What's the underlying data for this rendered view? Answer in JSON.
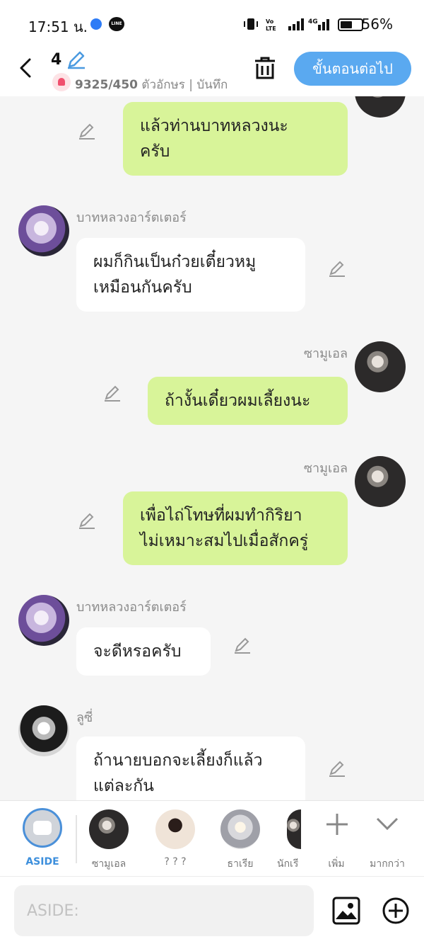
{
  "status_bar": {
    "time": "17:51 น.",
    "app_badge": "LINE",
    "battery": "56%"
  },
  "header": {
    "episode_number": "4",
    "char_count": "9325/450",
    "char_label": " ตัวอักษร | บันทึก",
    "next_label": "ขั้นตอนต่อไป"
  },
  "messages": [
    {
      "side": "out",
      "sender": "",
      "text": [
        "แล้วท่านบาทหลวงนะ",
        "ครับ"
      ]
    },
    {
      "side": "in",
      "sender": "บาทหลวงอาร์ตเตอร์",
      "text": [
        "ผมก็กินเป็นก๋วยเตี๋ยวหมู",
        "เหมือนกันครับ"
      ]
    },
    {
      "side": "out",
      "sender": "ซามูเอล",
      "text": [
        "ถ้างั้นเดี๋ยวผมเลี้ยงนะ"
      ]
    },
    {
      "side": "out",
      "sender": "ซามูเอล",
      "text": [
        "เพื่อไถ่โทษที่ผมทำกิริยา",
        "ไม่เหมาะสมไปเมื่อสักครู่"
      ]
    },
    {
      "side": "in",
      "sender": "บาทหลวงอาร์ตเตอร์",
      "text": [
        "จะดีหรอครับ"
      ]
    },
    {
      "side": "in",
      "sender": "ลูซี่",
      "text": [
        "ถ้านายบอกจะเลี้ยงก็แล้ว",
        "แต่ละกัน"
      ]
    }
  ],
  "cast": {
    "aside_label": "ASIDE",
    "members": [
      "ซามูเอล",
      "? ? ?",
      "ธาเรีย",
      "นักเรี"
    ],
    "add_label": "เพิ่ม",
    "more_label": "มากกว่า"
  },
  "input": {
    "placeholder": "ASIDE:"
  }
}
